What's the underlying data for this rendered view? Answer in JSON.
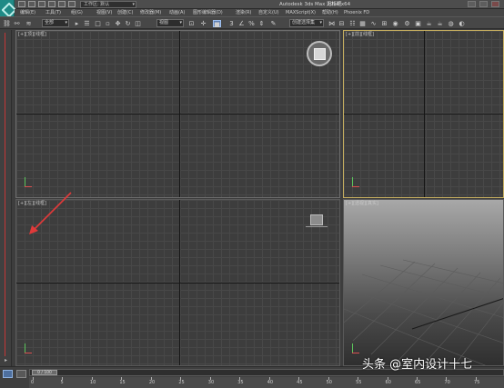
{
  "titlebar": {
    "workspace_label": "工作区: 默认",
    "app_title": "Autodesk 3ds Max  2014 x64",
    "doc_title": "无标题"
  },
  "menus": [
    "编辑(E)",
    "工具(T)",
    "组(G)",
    "视图(V)",
    "创建(C)",
    "修改器(M)",
    "动画(A)",
    "图形编辑器(D)",
    "渲染(R)",
    "自定义(U)",
    "MAXScript(X)",
    "帮助(H)",
    "Phoenix FD"
  ],
  "toolbar": {
    "filter_select": "全部",
    "refcoord_select": "视图",
    "selset_select": "创建选择集"
  },
  "viewports": {
    "top": "[+][顶][线框]",
    "front": "[+][前][线框]",
    "left": "[+][左][线框]",
    "perspective": "[+][透视][真实]"
  },
  "timeline": {
    "slider_label": "0 / 100",
    "ticks": [
      "0",
      "5",
      "10",
      "15",
      "20",
      "25",
      "30",
      "35",
      "40",
      "45",
      "50",
      "55",
      "60",
      "65",
      "70",
      "75"
    ]
  },
  "watermark": "头条 @室内设计十七",
  "colors": {
    "annotation_arrow": "#e03a3a",
    "active_viewport_border": "#c8b060"
  }
}
